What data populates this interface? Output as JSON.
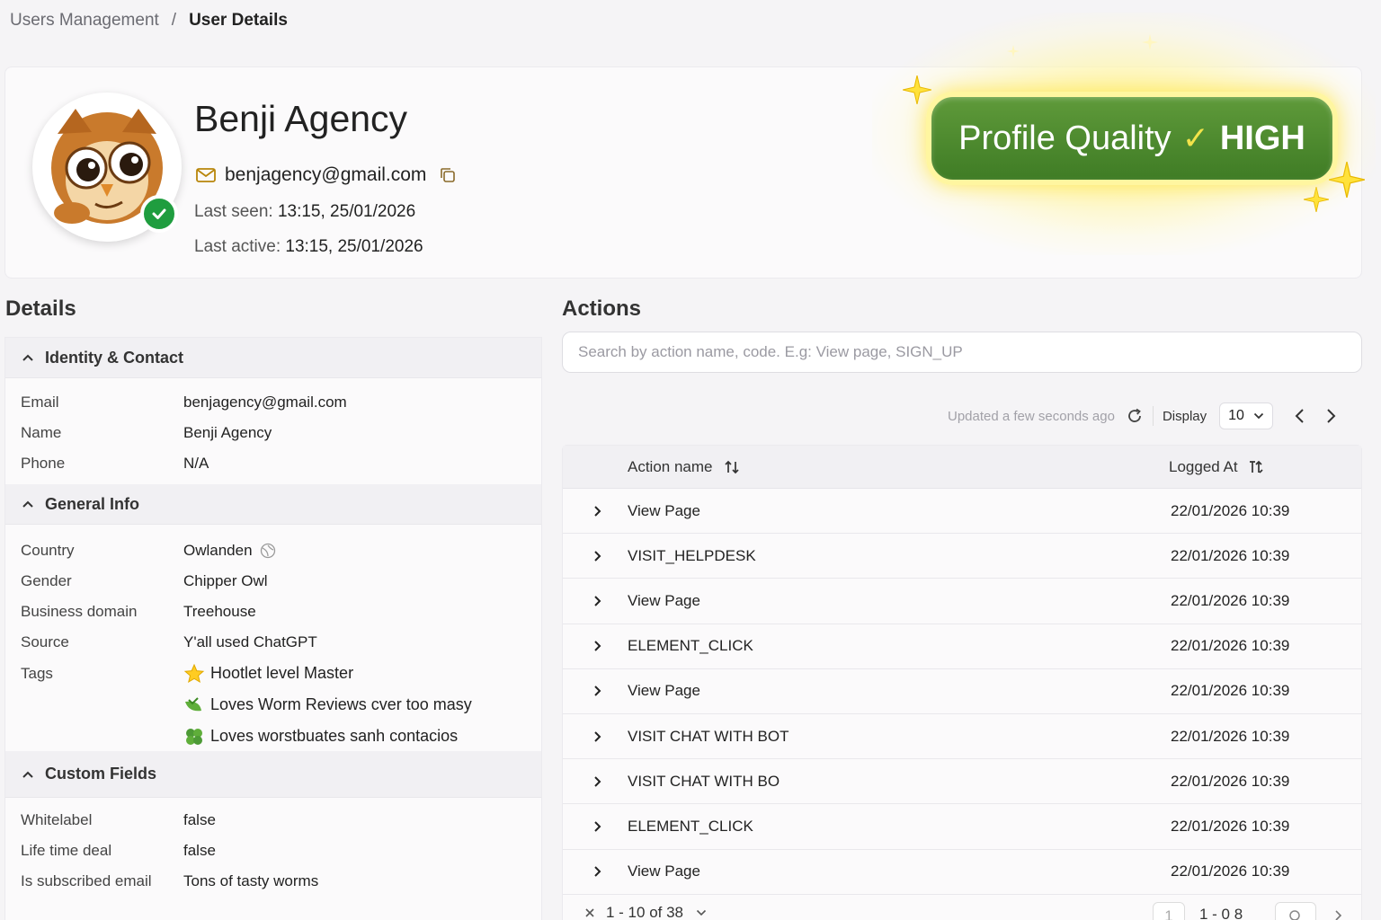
{
  "breadcrumb": {
    "parent": "Users Management",
    "separator": "/",
    "current": "User Details"
  },
  "profile": {
    "name": "Benji Agency",
    "email": "benjagency@gmail.com",
    "last_seen_label": "Last seen:",
    "last_seen_value": "13:15, 25/01/2026",
    "last_active_label": "Last active:",
    "last_active_value": "13:15, 25/01/2026"
  },
  "quality": {
    "label": "Profile Quality",
    "level": "HIGH",
    "check": "✓"
  },
  "sections": {
    "details": "Details",
    "actions": "Actions"
  },
  "details": {
    "identity": {
      "title": "Identity & Contact",
      "rows": [
        {
          "k": "Email",
          "v": "benjagency@gmail.com"
        },
        {
          "k": "Name",
          "v": "Benji Agency"
        },
        {
          "k": "Phone",
          "v": "N/A"
        }
      ]
    },
    "general": {
      "title": "General Info",
      "rows": [
        {
          "k": "Country",
          "v": "Owlanden"
        },
        {
          "k": "Gender",
          "v": "Chipper Owl"
        },
        {
          "k": "Business domain",
          "v": "Treehouse"
        },
        {
          "k": "Source",
          "v": "Y'all used ChatGPT"
        }
      ],
      "tags_label": "Tags",
      "tags": [
        "Hootlet level Master",
        "Loves Worm Reviews cver too masy",
        "Loves worstbuates sanh contacios"
      ]
    },
    "custom": {
      "title": "Custom Fields",
      "rows": [
        {
          "k": "Whitelabel",
          "v": "false"
        },
        {
          "k": "Life time deal",
          "v": "false"
        },
        {
          "k": "Is subscribed email",
          "v": "Tons of tasty worms"
        }
      ]
    }
  },
  "actions": {
    "search_placeholder": "Search by action name, code. E.g: View page, SIGN_UP",
    "updated_text": "Updated a few seconds ago",
    "display_label": "Display",
    "page_size": "10",
    "columns": {
      "name": "Action name",
      "logged": "Logged At"
    },
    "rows": [
      {
        "name": "View Page",
        "logged": "22/01/2026 10:39"
      },
      {
        "name": "VISIT_HELPDESK",
        "logged": "22/01/2026 10:39"
      },
      {
        "name": "View Page",
        "logged": "22/01/2026 10:39"
      },
      {
        "name": "ELEMENT_CLICK",
        "logged": "22/01/2026 10:39"
      },
      {
        "name": "View Page",
        "logged": "22/01/2026 10:39"
      },
      {
        "name": "VISIT CHAT WITH BOT",
        "logged": "22/01/2026 10:39"
      },
      {
        "name": "VISIT CHAT WITH BO",
        "logged": "22/01/2026 10:39"
      },
      {
        "name": "ELEMENT_CLICK",
        "logged": "22/01/2026 10:39"
      },
      {
        "name": "View Page",
        "logged": "22/01/2026 10:39"
      }
    ],
    "footer": {
      "range": "1 - 10 of 38",
      "page": "1",
      "range_short": "1 - 0 8"
    }
  },
  "colors": {
    "accent_green": "#3f7c25",
    "verified": "#1f9d3f",
    "glow": "#fff1a0"
  }
}
